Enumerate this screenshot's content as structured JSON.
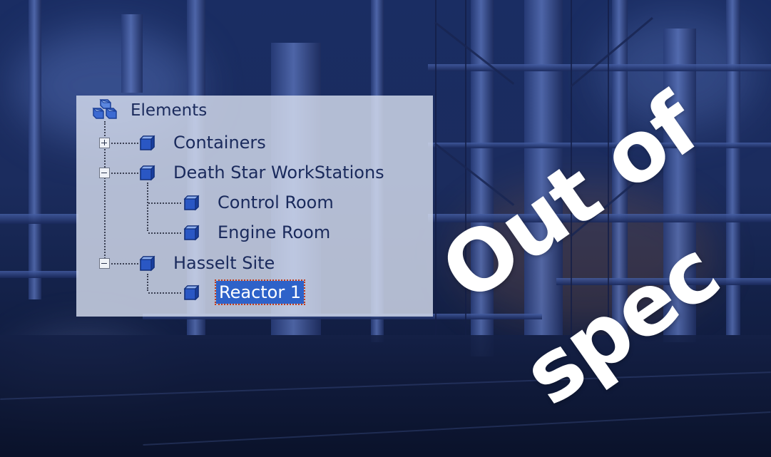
{
  "tree": {
    "root": {
      "label": "Elements",
      "icon": "elements-stack-icon"
    },
    "items": [
      {
        "label": "Containers",
        "icon": "cube-icon",
        "expander": "plus",
        "level": 1
      },
      {
        "label": "Death Star WorkStations",
        "icon": "cube-icon",
        "expander": "minus",
        "level": 1
      },
      {
        "label": "Control Room",
        "icon": "cube-icon",
        "level": 2
      },
      {
        "label": "Engine Room",
        "icon": "cube-icon",
        "level": 2
      },
      {
        "label": "Hasselt Site",
        "icon": "cube-icon",
        "expander": "minus",
        "level": 1
      },
      {
        "label": "Reactor 1",
        "icon": "cube-icon",
        "level": 2,
        "selected": true
      }
    ]
  },
  "overlay": {
    "line1": "Out of",
    "line2": "spec"
  },
  "colors": {
    "panel_background": "#d6ddee",
    "tree_text": "#1a2a5c",
    "selection": "#2e62c9",
    "selection_border": "#c23a1a",
    "icon_blue": "#2a57c4",
    "overlay_text": "#ffffff",
    "scene_blue": "#1b2c5e"
  }
}
